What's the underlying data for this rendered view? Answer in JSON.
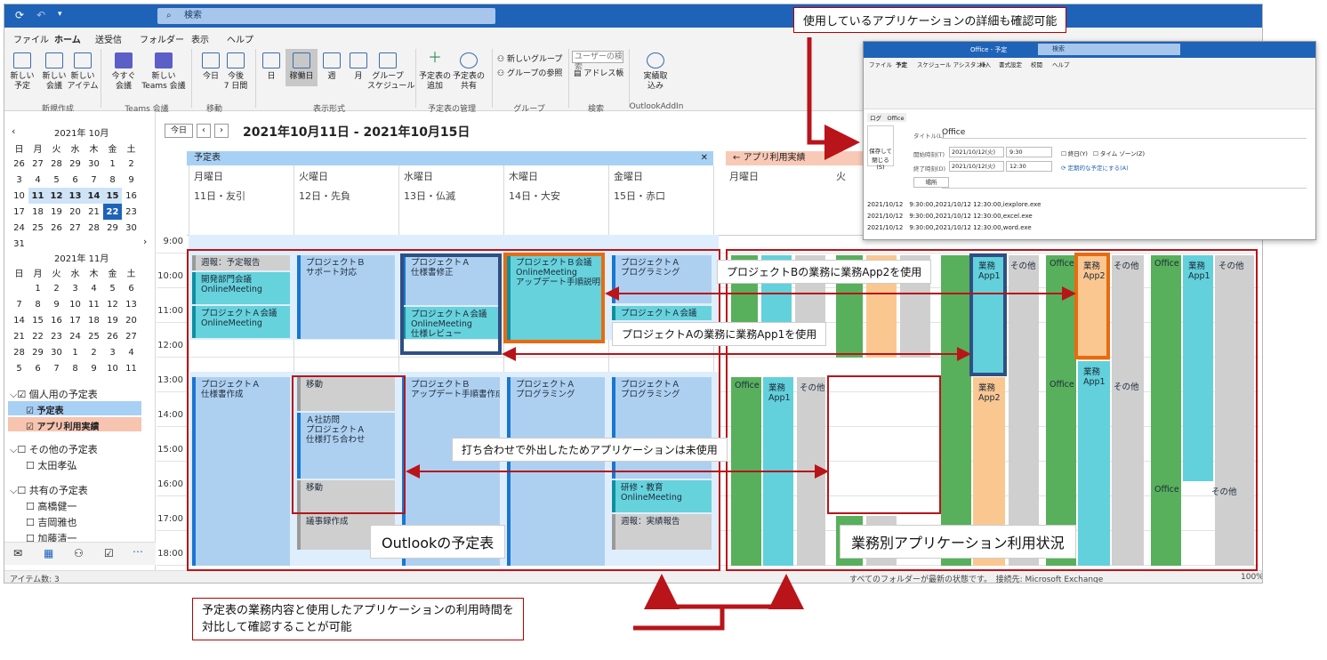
{
  "quickaccess": {
    "search": "検索"
  },
  "menu": [
    "ファイル",
    "ホーム",
    "送受信",
    "フォルダー",
    "表示",
    "ヘルプ"
  ],
  "ribbon": {
    "new_appt": "新しい\n予定",
    "new_meeting": "新しい\n会議",
    "new_items": "新しい\nアイテム",
    "grp_new": "新規作成",
    "meet_now": "今すぐ\n会議",
    "teams": "新しい\nTeams 会議",
    "grp_teams": "Teams 会議",
    "today": "今日",
    "next7": "今後\n7 日間",
    "grp_move": "移動",
    "day": "日",
    "workweek": "稼働日",
    "week": "週",
    "month": "月",
    "group_sched": "グループ\nスケジュール",
    "grp_arrange": "表示形式",
    "open_cal": "予定表の\n追加",
    "share": "予定表の\n共有",
    "grp_manage": "予定表の管理",
    "new_group": "新しいグループ",
    "browse_group": "グループの参照",
    "grp_groups": "グループ",
    "user_search": "ユーザーの検索",
    "address": "アドレス帳",
    "grp_find": "検索",
    "addin": "実績取\n込み",
    "grp_addin": "OutlookAddIn"
  },
  "minical": {
    "oct_title": "2021年 10月",
    "nov_title": "2021年 11月",
    "weekdays": [
      "日",
      "月",
      "火",
      "水",
      "木",
      "金",
      "土"
    ],
    "oct": [
      [
        "26",
        "27",
        "28",
        "29",
        "30",
        "1",
        "2"
      ],
      [
        "3",
        "4",
        "5",
        "6",
        "7",
        "8",
        "9"
      ],
      [
        "10",
        "11",
        "12",
        "13",
        "14",
        "15",
        "16"
      ],
      [
        "17",
        "18",
        "19",
        "20",
        "21",
        "22",
        "23"
      ],
      [
        "24",
        "25",
        "26",
        "27",
        "28",
        "29",
        "30"
      ],
      [
        "31"
      ]
    ],
    "nov": [
      [
        "",
        "1",
        "2",
        "3",
        "4",
        "5",
        "6"
      ],
      [
        "7",
        "8",
        "9",
        "10",
        "11",
        "12",
        "13"
      ],
      [
        "14",
        "15",
        "16",
        "17",
        "18",
        "19",
        "20"
      ],
      [
        "21",
        "22",
        "23",
        "24",
        "25",
        "26",
        "27"
      ],
      [
        "28",
        "29",
        "30",
        "1",
        "2",
        "3",
        "4"
      ],
      [
        "5",
        "6",
        "7",
        "8",
        "9",
        "10",
        "11"
      ]
    ]
  },
  "folders": {
    "personal": "個人用の予定表",
    "cal1": "予定表",
    "cal2": "アプリ利用実績",
    "other": "その他の予定表",
    "other1": "太田孝弘",
    "shared": "共有の予定表",
    "s1": "高橋健一",
    "s2": "吉岡雅也",
    "s3": "加藤清一"
  },
  "status": "アイテム数: 3",
  "status_right": "すべてのフォルダーが最新の状態です。　接続先: Microsoft Exchange",
  "zoom": "100%",
  "nav": {
    "today": "今日",
    "range": "2021年10月11日 - 2021年10月15日"
  },
  "cal_left": "予定表",
  "cal_right": "アプリ利用実績",
  "days": [
    {
      "h": "月曜日",
      "d": "11日・友引"
    },
    {
      "h": "火曜日",
      "d": "12日・先負"
    },
    {
      "h": "水曜日",
      "d": "13日・仏滅"
    },
    {
      "h": "木曜日",
      "d": "14日・大安"
    },
    {
      "h": "金曜日",
      "d": "15日・赤口"
    }
  ],
  "right_days": [
    "月曜日",
    "火"
  ],
  "hours": [
    "9:00",
    "10:00",
    "11:00",
    "12:00",
    "13:00",
    "14:00",
    "15:00",
    "16:00",
    "17:00",
    "18:00"
  ],
  "events": {
    "e1": "週報：予定報告",
    "e2": "開発部門会議\nOnlineMeeting",
    "e3": "プロジェクトＡ会議\nOnlineMeeting",
    "e4": "プロジェクトＡ\n仕様書作成",
    "e5": "プロジェクトＢ\nサポート対応",
    "e6": "移動",
    "e7": "Ａ社訪問\nプロジェクトＡ\n仕様打ち合わせ",
    "e8": "移動",
    "e9": "議事録作成",
    "e10": "プロジェクトＡ\n仕様書修正",
    "e11": "プロジェクトＡ会議\nOnlineMeeting\n仕様レビュー",
    "e12": "プロジェクトＢ\nアップデート手順書作成",
    "e13": "プロジェクトＢ会議\nOnlineMeeting\nアップデート手順説明",
    "e14": "プロジェクトＡ\nプログラミング",
    "e15": "プロジェクトＡ\nプログラミング",
    "e16": "プロジェクトＡ会議",
    "e17": "プロジェクトＡ\nプログラミング",
    "e18": "研修・教育\nOnlineMeeting",
    "e19": "週報：実績報告"
  },
  "apps": {
    "office": "Office",
    "app1": "業務\nApp1",
    "app2": "業務\nApp2",
    "other": "その他"
  },
  "popup": {
    "title": "Office - 予定",
    "search": "検索",
    "menu": [
      "ファイル",
      "予定",
      "スケジュール アシスタント",
      "挿入",
      "書式設定",
      "校閲",
      "ヘルプ"
    ],
    "tags": "ログ　Office",
    "save": "保存して\n閉じる\n(S)",
    "title_lbl": "タイトル(L)",
    "title_val": "Office",
    "start_lbl": "開始時刻(T)",
    "start_date": "2021/10/12(火)",
    "start_time": "9:30",
    "end_lbl": "終了時刻(D)",
    "end_date": "2021/10/12(火)",
    "end_time": "12:30",
    "allday": "終日(Y)",
    "tz": "タイム ゾーン(Z)",
    "recur": "定期的な予定にする(A)",
    "place_lbl": "場所",
    "log1": "2021/10/12　9:30:00,2021/10/12 12:30:00,iexplore.exe",
    "log2": "2021/10/12　9:30:00,2021/10/12 12:30:00,excel.exe",
    "log3": "2021/10/12　9:30:00,2021/10/12 12:30:00,word.exe"
  },
  "callouts": {
    "c1": "使用しているアプリケーションの詳細も確認可能",
    "c2": "プロジェクトBの業務に業務App2を使用",
    "c3": "プロジェクトAの業務に業務App1を使用",
    "c4": "打ち合わせで外出したためアプリケーションは未使用",
    "c5": "Outlookの予定表",
    "c6": "業務別アプリケーション利用状況",
    "c7": "予定表の業務内容と使用したアプリケーションの利用時間を\n対比して確認することが可能"
  }
}
